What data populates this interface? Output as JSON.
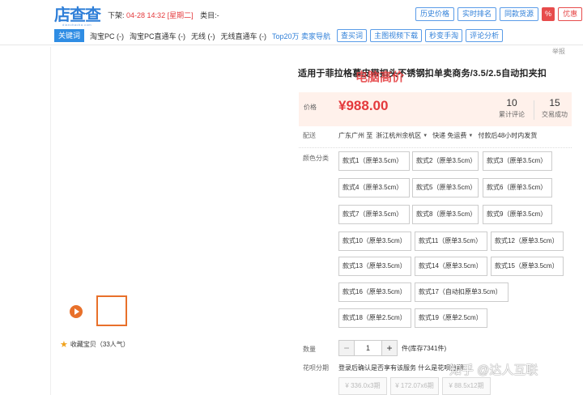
{
  "plugin": {
    "logo_text": "店查查",
    "logo_sub": "dianchacha.com",
    "shelf_label": "下架:",
    "shelf_date": "04-28 14:32 [星期二]",
    "category_label": "类目:-",
    "buttons": {
      "history_price": "历史价格",
      "realtime_rank": "实时排名",
      "same_source": "同款货源",
      "percent": "%",
      "coupon": "优惠"
    },
    "keyword_label": "关键词",
    "keywords": [
      "淘宝PC (-)",
      "淘宝PC直通车 (-)",
      "无线 (-)",
      "无线直通车 (-)"
    ],
    "top20": "Top20万 卖家导航",
    "tools": [
      "查买词",
      "主图视频下载",
      "秒变手淘",
      "评论分析"
    ]
  },
  "product": {
    "report": "举报",
    "title": "适用于菲拉格慕皮带扣头不锈钢扣单卖商务/3.5/2.5自动扣夹扣",
    "price_label": "价格",
    "price": "¥988.00",
    "stats": [
      {
        "num": "10",
        "label": "累计评论"
      },
      {
        "num": "15",
        "label": "交易成功"
      }
    ],
    "overlay_text": "电脑高价",
    "ship": {
      "label": "配送",
      "from": "广东广州 至",
      "to": "浙江杭州余杭区",
      "method": "快递 免运费",
      "promise": "付款后48小时内发货"
    },
    "color_label": "颜色分类",
    "skus": [
      "款式1（原单3.5cm）",
      "款式2（原单3.5cm）",
      "款式3（原单3.5cm）",
      "款式4（原单3.5cm）",
      "款式5（原单3.5cm）",
      "款式6（原单3.5cm）",
      "款式7（原单3.5cm）",
      "款式8（原单3.5cm）",
      "款式9（原单3.5cm）",
      "款式10（原单3.5cm）",
      "款式11（原单3.5cm）",
      "款式12（原单3.5cm）",
      "款式13（原单3.5cm）",
      "款式14（原单3.5cm）",
      "款式15（原单3.5cm）",
      "款式16（原单3.5cm）",
      "款式17（自动扣原单3.5cm）",
      "款式18（原单2.5cm）",
      "款式19（原单2.5cm）"
    ],
    "qty_label": "数量",
    "qty_minus": "−",
    "qty_value": "1",
    "qty_plus": "+",
    "stock": "件(库存7341件)",
    "hb_label": "花呗分期",
    "hb_text": "登录后确认是否享有该服务  什么是花呗分期",
    "hb_tags": [
      "¥ 336.0x3期",
      "¥ 172.07x6期",
      "¥ 88.5x12期"
    ],
    "favorite": "收藏宝贝（33人气）",
    "watermark": "知乎 @达人互联"
  }
}
